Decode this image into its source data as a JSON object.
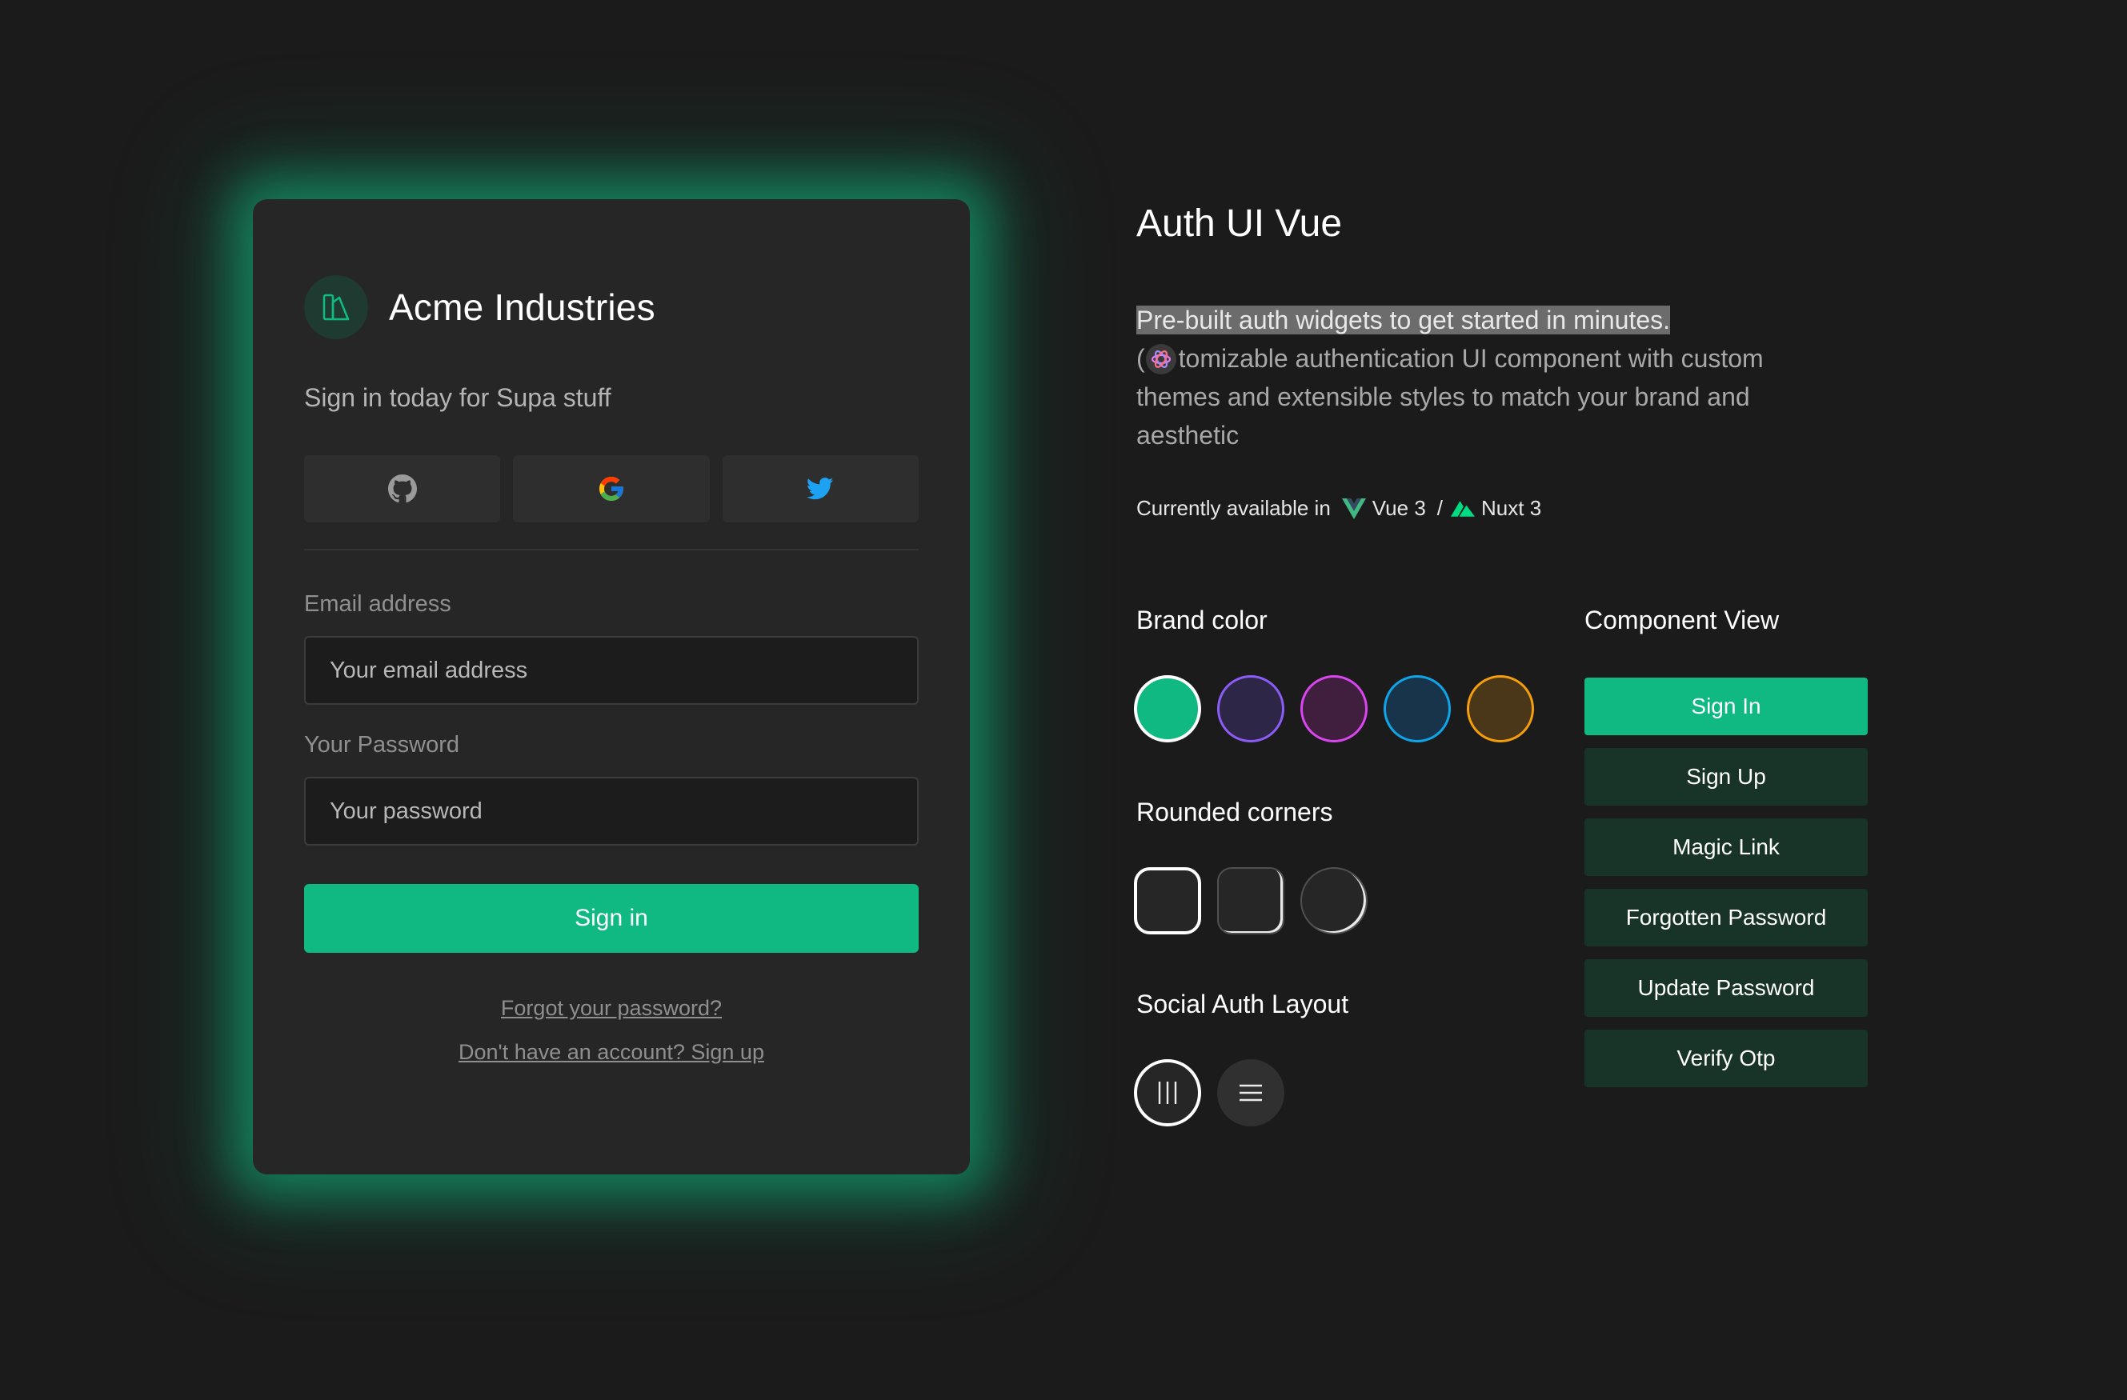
{
  "card": {
    "company_name": "Acme Industries",
    "tagline": "Sign in today for Supa stuff",
    "social_providers": [
      "github-icon",
      "google-icon",
      "twitter-icon"
    ],
    "email_label": "Email address",
    "email_placeholder": "Your email address",
    "password_label": "Your Password",
    "password_placeholder": "Your password",
    "sign_in_label": "Sign in",
    "forgot_link": "Forgot your password?",
    "signup_link": "Don't have an account? Sign up"
  },
  "panel": {
    "title": "Auth UI Vue",
    "description_highlight": "Pre-built auth widgets to get started in minutes.",
    "description_line2_prefix": "(",
    "description_line2_rest": "tomizable authentication UI component with custom",
    "description_line3": "themes and extensible styles to match your brand and",
    "description_line4": "aesthetic",
    "available_label": "Currently available in",
    "framework_1": "Vue 3",
    "separator": "/",
    "framework_2": "Nuxt 3",
    "brand_color_title": "Brand color",
    "brand_colors": [
      {
        "fill": "#10b981",
        "border": "#ffffff",
        "selected": true
      },
      {
        "fill": "#2e2647",
        "border": "#8b5cf6",
        "selected": false
      },
      {
        "fill": "#3f1f3d",
        "border": "#d946ef",
        "selected": false
      },
      {
        "fill": "#17344a",
        "border": "#0ea5e9",
        "selected": false
      },
      {
        "fill": "#4a3618",
        "border": "#f59e0b",
        "selected": false
      }
    ],
    "rounded_title": "Rounded corners",
    "social_layout_title": "Social Auth Layout",
    "component_view_title": "Component View",
    "component_views": [
      "Sign In",
      "Sign Up",
      "Magic Link",
      "Forgotten Password",
      "Update Password",
      "Verify Otp"
    ],
    "active_view": "Sign In"
  },
  "colors": {
    "accent": "#10b981",
    "background": "#1b1b1b",
    "card": "#262626"
  }
}
